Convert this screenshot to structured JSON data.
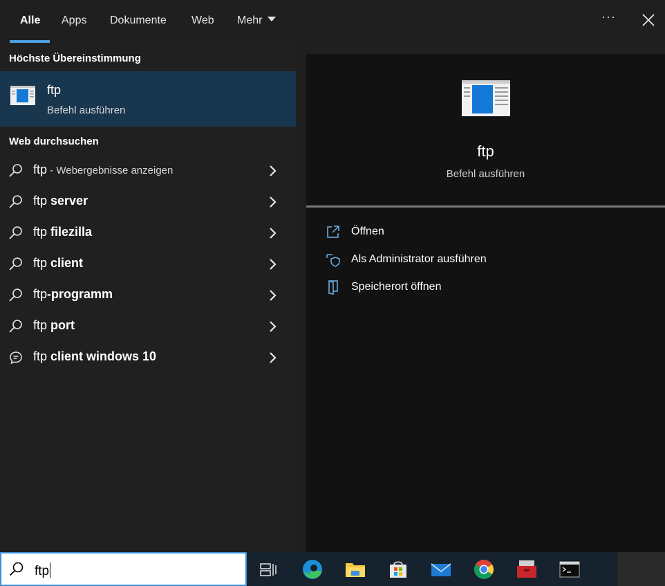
{
  "tabs": [
    {
      "label": "Alle",
      "active": true
    },
    {
      "label": "Apps"
    },
    {
      "label": "Dokumente"
    },
    {
      "label": "Web"
    },
    {
      "label": "Mehr"
    }
  ],
  "left": {
    "best_match_heading": "Höchste Übereinstimmung",
    "best_match": {
      "title": "ftp",
      "subtitle": "Befehl ausführen",
      "icon": "run-command-icon"
    },
    "web_heading": "Web durchsuchen",
    "web_items": [
      {
        "prefix": "ftp",
        "bold": "",
        "hint": " - Webergebnisse anzeigen",
        "icon": "search-icon"
      },
      {
        "prefix": "ftp ",
        "bold": "server",
        "hint": "",
        "icon": "search-icon"
      },
      {
        "prefix": "ftp ",
        "bold": "filezilla",
        "hint": "",
        "icon": "search-icon"
      },
      {
        "prefix": "ftp ",
        "bold": "client",
        "hint": "",
        "icon": "search-icon"
      },
      {
        "prefix": "ftp",
        "bold": "-programm",
        "hint": "",
        "icon": "search-icon"
      },
      {
        "prefix": "ftp ",
        "bold": "port",
        "hint": "",
        "icon": "search-icon"
      },
      {
        "prefix": "ftp ",
        "bold": "client windows 10",
        "hint": "",
        "icon": "chat-bubble-icon"
      }
    ]
  },
  "detail": {
    "title": "ftp",
    "subtitle": "Befehl ausführen",
    "actions": [
      {
        "label": "Öffnen",
        "icon": "open-icon"
      },
      {
        "label": "Als Administrator ausführen",
        "icon": "admin-shield-icon"
      },
      {
        "label": "Speicherort öffnen",
        "icon": "file-location-icon"
      }
    ]
  },
  "taskbar": {
    "search_value": "ftp",
    "apps": [
      "task-view-icon",
      "edge-icon",
      "file-explorer-icon",
      "store-icon",
      "mail-icon",
      "chrome-icon",
      "toolbox-icon",
      "terminal-icon"
    ]
  },
  "colors": {
    "accent": "#4ca0e0",
    "selected_row": "#19364f",
    "pane_bg": "#202020",
    "detail_bg": "#121212",
    "taskbar": "#16222e"
  }
}
